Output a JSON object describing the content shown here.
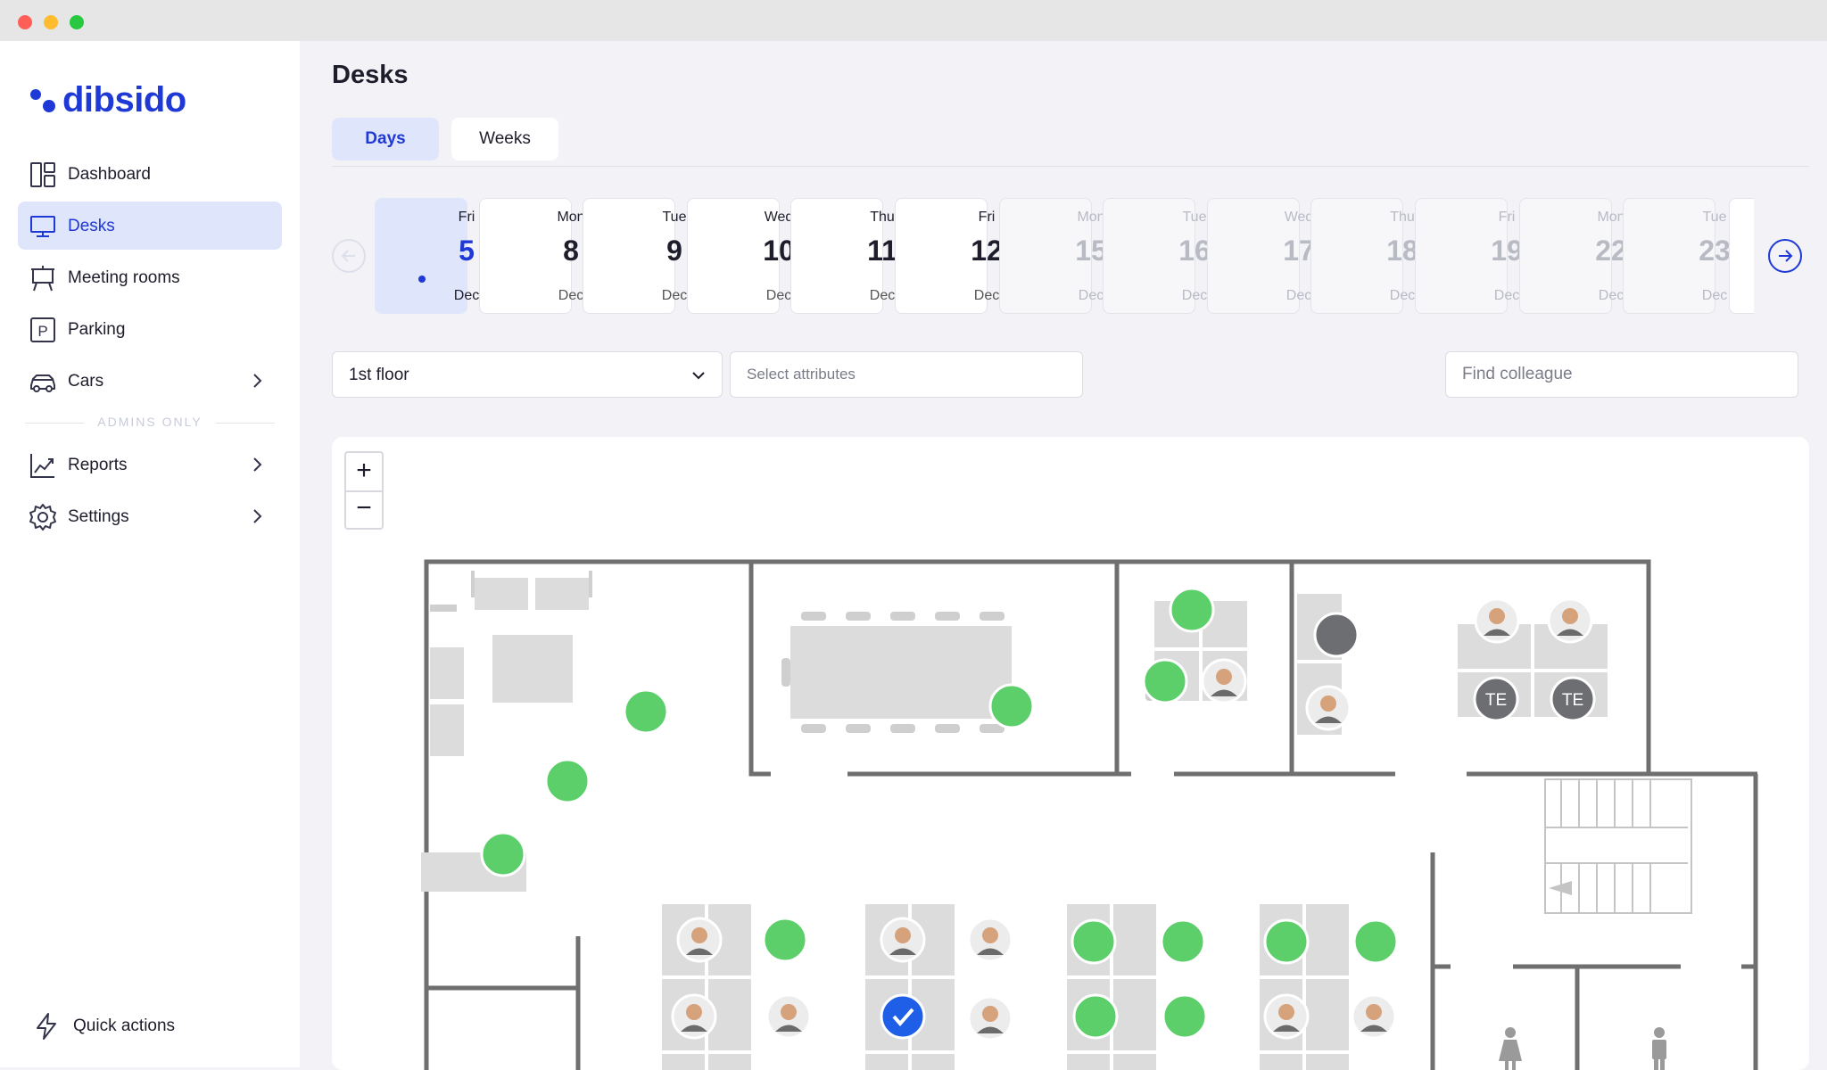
{
  "app": {
    "logo_text": "dibsido"
  },
  "sidebar": {
    "items": [
      {
        "label": "Dashboard",
        "icon": "dashboard-icon",
        "active": false,
        "has_chevron": false
      },
      {
        "label": "Desks",
        "icon": "monitor-icon",
        "active": true,
        "has_chevron": false
      },
      {
        "label": "Meeting rooms",
        "icon": "presentation-board-icon",
        "active": false,
        "has_chevron": false
      },
      {
        "label": "Parking",
        "icon": "parking-icon",
        "active": false,
        "has_chevron": false
      },
      {
        "label": "Cars",
        "icon": "car-icon",
        "active": false,
        "has_chevron": true
      }
    ],
    "admins_label": "ADMINS ONLY",
    "admin_items": [
      {
        "label": "Reports",
        "icon": "chart-line-icon",
        "has_chevron": true
      },
      {
        "label": "Settings",
        "icon": "gear-icon",
        "has_chevron": true
      }
    ],
    "quick_actions_label": "Quick actions"
  },
  "page": {
    "title": "Desks",
    "tabs": [
      {
        "label": "Days",
        "active": true
      },
      {
        "label": "Weeks",
        "active": false
      }
    ]
  },
  "dates": [
    {
      "dow": "Fri",
      "num": "5",
      "month": "Dec",
      "state": "selected"
    },
    {
      "dow": "Mon",
      "num": "8",
      "month": "Dec",
      "state": "available"
    },
    {
      "dow": "Tue",
      "num": "9",
      "month": "Dec",
      "state": "available"
    },
    {
      "dow": "Wed",
      "num": "10",
      "month": "Dec",
      "state": "available"
    },
    {
      "dow": "Thu",
      "num": "11",
      "month": "Dec",
      "state": "available"
    },
    {
      "dow": "Fri",
      "num": "12",
      "month": "Dec",
      "state": "available"
    },
    {
      "dow": "Mon",
      "num": "15",
      "month": "Dec",
      "state": "unavailable"
    },
    {
      "dow": "Tue",
      "num": "16",
      "month": "Dec",
      "state": "unavailable"
    },
    {
      "dow": "Wed",
      "num": "17",
      "month": "Dec",
      "state": "unavailable"
    },
    {
      "dow": "Thu",
      "num": "18",
      "month": "Dec",
      "state": "unavailable"
    },
    {
      "dow": "Fri",
      "num": "19",
      "month": "Dec",
      "state": "unavailable"
    },
    {
      "dow": "Mon",
      "num": "22",
      "month": "Dec",
      "state": "unavailable"
    },
    {
      "dow": "Tue",
      "num": "23",
      "month": "Dec",
      "state": "unavailable"
    }
  ],
  "filters": {
    "floor_value": "1st floor",
    "attributes_placeholder": "Select attributes",
    "colleague_placeholder": "Find colleague"
  },
  "map": {
    "zoom_in": "+",
    "zoom_out": "−",
    "initials_badge": "TE",
    "colors": {
      "free_seat": "#5ccf6b",
      "unavailable_seat": "#6d6e72",
      "selected_seat": "#1f5ee6",
      "furniture": "#dcdcdc",
      "wall": "#6f6f6f"
    }
  },
  "colors": {
    "accent": "#1f39d6",
    "active_bg": "#dfe5fb"
  }
}
